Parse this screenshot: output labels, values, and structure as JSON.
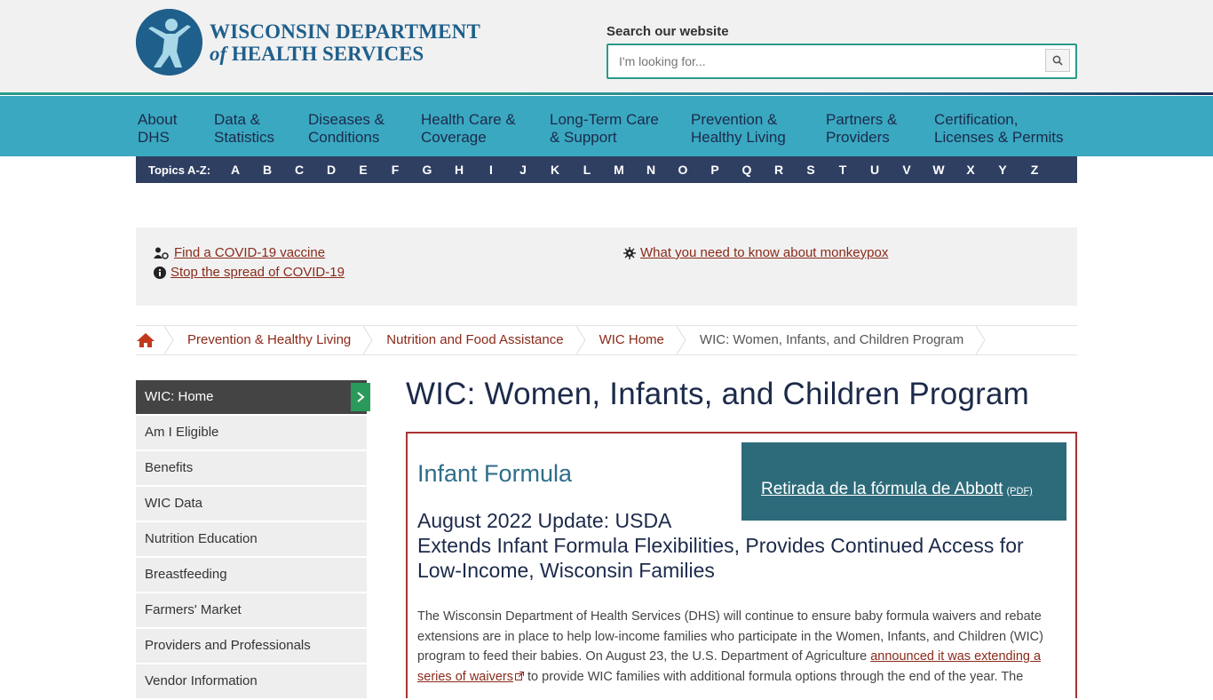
{
  "header": {
    "logo_line1": "WISCONSIN DEPARTMENT",
    "logo_of": "of",
    "logo_line2": "HEALTH SERVICES",
    "search_label": "Search our website",
    "search_placeholder": "I'm looking for..."
  },
  "nav": {
    "items": [
      {
        "line1": "About",
        "line2": "DHS"
      },
      {
        "line1": "Data &",
        "line2": "Statistics"
      },
      {
        "line1": "Diseases &",
        "line2": "Conditions"
      },
      {
        "line1": "Health Care &",
        "line2": "Coverage"
      },
      {
        "line1": "Long-Term Care",
        "line2": "& Support"
      },
      {
        "line1": "Prevention &",
        "line2": "Healthy Living"
      },
      {
        "line1": "Partners &",
        "line2": "Providers"
      },
      {
        "line1": "Certification,",
        "line2": "Licenses & Permits"
      }
    ]
  },
  "az": {
    "label": "Topics A-Z:",
    "letters": [
      "A",
      "B",
      "C",
      "D",
      "E",
      "F",
      "G",
      "H",
      "I",
      "J",
      "K",
      "L",
      "M",
      "N",
      "O",
      "P",
      "Q",
      "R",
      "S",
      "T",
      "U",
      "V",
      "W",
      "X",
      "Y",
      "Z"
    ]
  },
  "alerts": {
    "vaccine": "Find a COVID-19 vaccine",
    "spread": "Stop the spread of COVID-19",
    "monkeypox": "What you need to know about monkeypox"
  },
  "breadcrumb": {
    "items": [
      "Prevention & Healthy Living",
      "Nutrition and Food Assistance",
      "WIC Home"
    ],
    "current": "WIC: Women, Infants, and Children Program"
  },
  "sidebar": {
    "items": [
      "WIC: Home",
      "Am I Eligible",
      "Benefits",
      "WIC Data",
      "Nutrition Education",
      "Breastfeeding",
      "Farmers' Market",
      "Providers and Professionals",
      "Vendor Information"
    ]
  },
  "main": {
    "title": "WIC: Women, Infants, and Children Program",
    "subtitle1": "Infant Formula",
    "promo_link": "Retirada de la fórmula de Abbott",
    "promo_pdf": "(PDF)",
    "subtitle2_line1": "August 2022 Update: USDA",
    "subtitle2_line2": "Extends Infant Formula Flexibilities, Provides Continued Access for Low-Income, Wisconsin Families",
    "body_part1": "The Wisconsin Department of Health Services (DHS) will continue to ensure baby formula waivers and rebate extensions are in place to help low-income families who participate in the Women, Infants, and Children (WIC) program to feed their babies. On August 23, the U.S. Department of Agriculture ",
    "body_link": "announced it was extending a series of waivers",
    "body_part2": " to provide WIC families with additional formula options through the end of the year. The"
  },
  "colors": {
    "nav_bg": "#3aa8c1",
    "az_bg": "#2f3f62",
    "link": "#8a2a1a",
    "promo_bg": "#2d6b7a",
    "box_border": "#a93333"
  }
}
